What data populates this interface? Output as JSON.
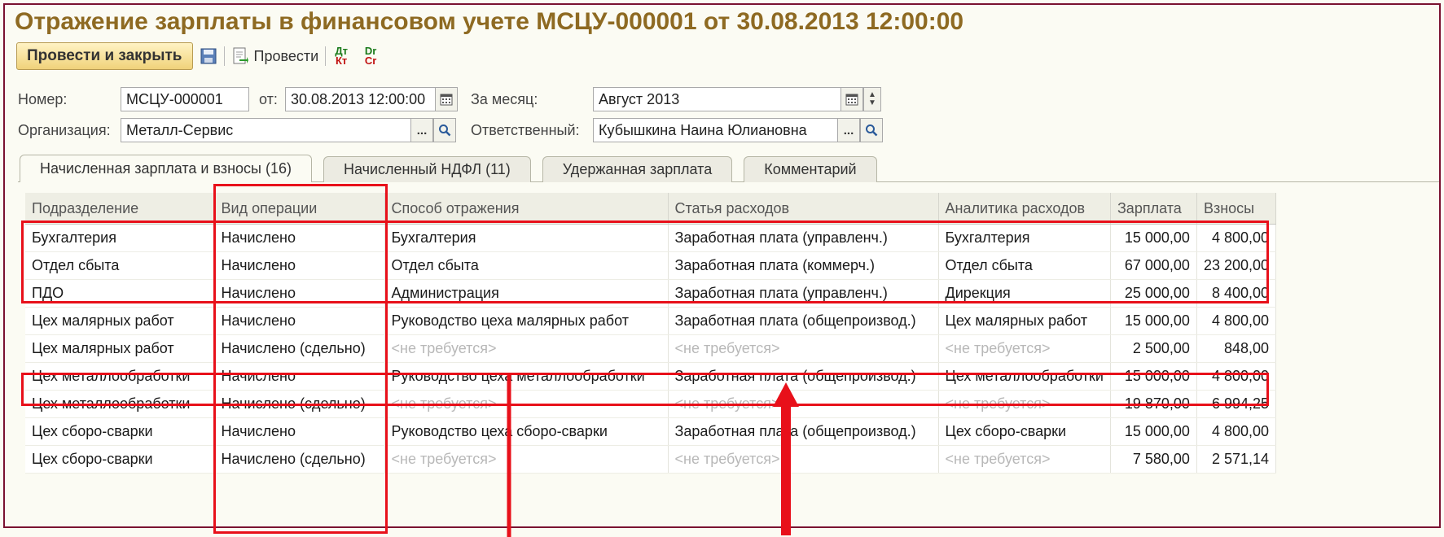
{
  "window": {
    "title": "Отражение зарплаты в финансовом учете МСЦУ-000001 от 30.08.2013 12:00:00"
  },
  "toolbar": {
    "post_close_label": "Провести и закрыть",
    "save_icon": "save-icon",
    "post_label": "Провести",
    "dtkt_label_top": "Дт",
    "dtkt_label_bottom": "Кт",
    "drcr_label_top": "Dr",
    "drcr_label_bottom": "Cr"
  },
  "form": {
    "number_label": "Номер:",
    "number_value": "МСЦУ-000001",
    "date_label": "от:",
    "date_value": "30.08.2013 12:00:00",
    "month_label": "За месяц:",
    "month_value": "Август 2013",
    "org_label": "Организация:",
    "org_value": "Металл-Сервис",
    "responsible_label": "Ответственный:",
    "responsible_value": "Кубышкина Наина Юлиановна",
    "select_button": "..."
  },
  "tabs": [
    {
      "label": "Начисленная зарплата и взносы (16)",
      "active": true
    },
    {
      "label": "Начисленный НДФЛ (11)",
      "active": false
    },
    {
      "label": "Удержанная зарплата",
      "active": false
    },
    {
      "label": "Комментарий",
      "active": false
    }
  ],
  "table": {
    "columns": [
      "Подразделение",
      "Вид операции",
      "Способ отражения",
      "Статья расходов",
      "Аналитика расходов",
      "Зарплата",
      "Взносы"
    ],
    "rows": [
      [
        "Бухгалтерия",
        "Начислено",
        "Бухгалтерия",
        "Заработная плата (управленч.)",
        "Бухгалтерия",
        "15 000,00",
        "4 800,00"
      ],
      [
        "Отдел сбыта",
        "Начислено",
        "Отдел сбыта",
        "Заработная плата (коммерч.)",
        "Отдел сбыта",
        "67 000,00",
        "23 200,00"
      ],
      [
        "ПДО",
        "Начислено",
        "Администрация",
        "Заработная плата (управленч.)",
        "Дирекция",
        "25 000,00",
        "8 400,00"
      ],
      [
        "Цех малярных работ",
        "Начислено",
        "Руководство цеха малярных работ",
        "Заработная плата (общепроизвод.)",
        "Цех малярных работ",
        "15 000,00",
        "4 800,00"
      ],
      [
        "Цех малярных работ",
        "Начислено (сдельно)",
        "<не требуется>",
        "<не требуется>",
        "<не требуется>",
        "2 500,00",
        "848,00"
      ],
      [
        "Цех металлообработки",
        "Начислено",
        "Руководство цеха металлообработки",
        "Заработная плата (общепроизвод.)",
        "Цех металлообработки",
        "15 000,00",
        "4 800,00"
      ],
      [
        "Цех металлообработки",
        "Начислено (сдельно)",
        "<не требуется>",
        "<не требуется>",
        "<не требуется>",
        "19 870,00",
        "6 994,25"
      ],
      [
        "Цех сборо-сварки",
        "Начислено",
        "Руководство цеха сборо-сварки",
        "Заработная плата (общепроизвод.)",
        "Цех сборо-сварки",
        "15 000,00",
        "4 800,00"
      ],
      [
        "Цех сборо-сварки",
        "Начислено (сдельно)",
        "<не требуется>",
        "<не требуется>",
        "<не требуется>",
        "7 580,00",
        "2 571,14"
      ]
    ]
  },
  "colors": {
    "title": "#8e6a22",
    "highlight": "#e8101a",
    "placeholder_text": "#b8b8b8"
  }
}
